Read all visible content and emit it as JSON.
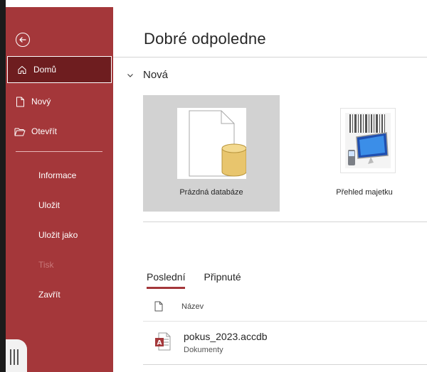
{
  "sidebar": {
    "back_label": "",
    "items": [
      {
        "label": "Domů",
        "icon": "home-icon"
      },
      {
        "label": "Nový",
        "icon": "new-file-icon"
      },
      {
        "label": "Otevřít",
        "icon": "folder-open-icon"
      },
      {
        "label": "Informace"
      },
      {
        "label": "Uložit"
      },
      {
        "label": "Uložit jako"
      },
      {
        "label": "Tisk"
      },
      {
        "label": "Zavřít"
      }
    ]
  },
  "main": {
    "greeting": "Dobré odpoledne",
    "new_section": "Nová",
    "templates": [
      {
        "label": "Prázdná databáze",
        "icon": "blank-database-icon"
      },
      {
        "label": "Přehled majetku",
        "icon": "asset-tracking-thumbnail"
      }
    ],
    "tabs": [
      "Poslední",
      "Připnuté"
    ],
    "list_header": "Název",
    "files": [
      {
        "name": "pokus_2023.accdb",
        "path": "Dokumenty",
        "icon": "access-file-icon"
      }
    ]
  },
  "colors": {
    "accent": "#a4373a",
    "active_nav": "#6e1d1f",
    "selected_tile": "#d2d2d2",
    "database_cylinder": "#e8c56d"
  }
}
